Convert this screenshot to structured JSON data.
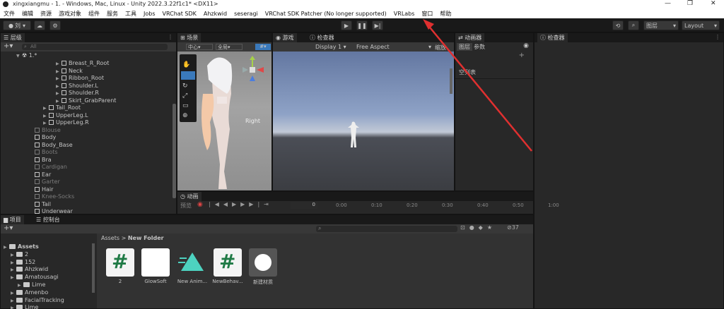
{
  "window": {
    "title": "xingxiangmu - 1. - Windows, Mac, Linux - Unity 2022.3.22f1c1* <DX11>"
  },
  "menu": [
    "文件",
    "编辑",
    "资源",
    "游戏对象",
    "组件",
    "服务",
    "工具",
    "Jobs",
    "VRChat SDK",
    "Ahzkwid",
    "seseragi",
    "VRChat SDK Patcher (No longer supported)",
    "VRLabs",
    "窗口",
    "帮助"
  ],
  "toolbar": {
    "account_label": "刘",
    "layers_label": "图层",
    "layout_label": "Layout"
  },
  "hierarchy": {
    "tab": "层级",
    "search_placeholder": "All",
    "scene": "1.*",
    "rows": [
      {
        "label": "Breast_R_Root",
        "dim": false
      },
      {
        "label": "Neck",
        "dim": false
      },
      {
        "label": "Ribbon_Root",
        "dim": false
      },
      {
        "label": "Shoulder.L",
        "dim": false
      },
      {
        "label": "Shoulder.R",
        "dim": false
      },
      {
        "label": "Skirt_GrabParent",
        "dim": false
      },
      {
        "label": "Tail_Root",
        "dim": false
      },
      {
        "label": "UpperLeg.L",
        "dim": false
      },
      {
        "label": "UpperLeg.R",
        "dim": false
      },
      {
        "label": "Blouse",
        "dim": true
      },
      {
        "label": "Body",
        "dim": false
      },
      {
        "label": "Body_Base",
        "dim": false
      },
      {
        "label": "Boots",
        "dim": true
      },
      {
        "label": "Bra",
        "dim": false
      },
      {
        "label": "Cardigan",
        "dim": true
      },
      {
        "label": "Ear",
        "dim": false
      },
      {
        "label": "Garter",
        "dim": true
      },
      {
        "label": "Hair",
        "dim": false
      },
      {
        "label": "Knee-Socks",
        "dim": true
      },
      {
        "label": "Tail",
        "dim": false
      },
      {
        "label": "Underwear",
        "dim": false
      }
    ]
  },
  "scene": {
    "tab": "场景",
    "pivot": "中心",
    "space": "全局",
    "view_label": "Right"
  },
  "game": {
    "tab": "游戏",
    "inspector_tab": "检查器",
    "display": "Display 1",
    "aspect": "Free Aspect",
    "scale": "缩放"
  },
  "animator": {
    "tab": "动画器",
    "layers_tab": "图层",
    "params_tab": "参数",
    "empty": "空列表"
  },
  "inspector": {
    "tab": "检查器"
  },
  "animation": {
    "tab": "动画",
    "preview": "预览",
    "frame": "0",
    "ticks": [
      "0:00",
      "0:10",
      "0:20",
      "0:30",
      "0:40",
      "0:50",
      "1:00"
    ]
  },
  "project": {
    "tab": "项目",
    "console_tab": "控制台",
    "breadcrumb_root": "Assets",
    "breadcrumb_current": "New Folder",
    "hidden_count": "37",
    "tree": [
      {
        "label": "Assets",
        "indent": 0,
        "bold": true
      },
      {
        "label": "2",
        "indent": 1
      },
      {
        "label": "152",
        "indent": 1
      },
      {
        "label": "Ahzkwid",
        "indent": 1
      },
      {
        "label": "Amatousagi",
        "indent": 1
      },
      {
        "label": "Lime",
        "indent": 2
      },
      {
        "label": "Amenbo",
        "indent": 1
      },
      {
        "label": "FacialTracking",
        "indent": 1
      },
      {
        "label": "Lime",
        "indent": 1
      }
    ],
    "assets": [
      "2",
      "GlowSoft",
      "New Anim...",
      "NewBehav...",
      "新建材质"
    ]
  }
}
